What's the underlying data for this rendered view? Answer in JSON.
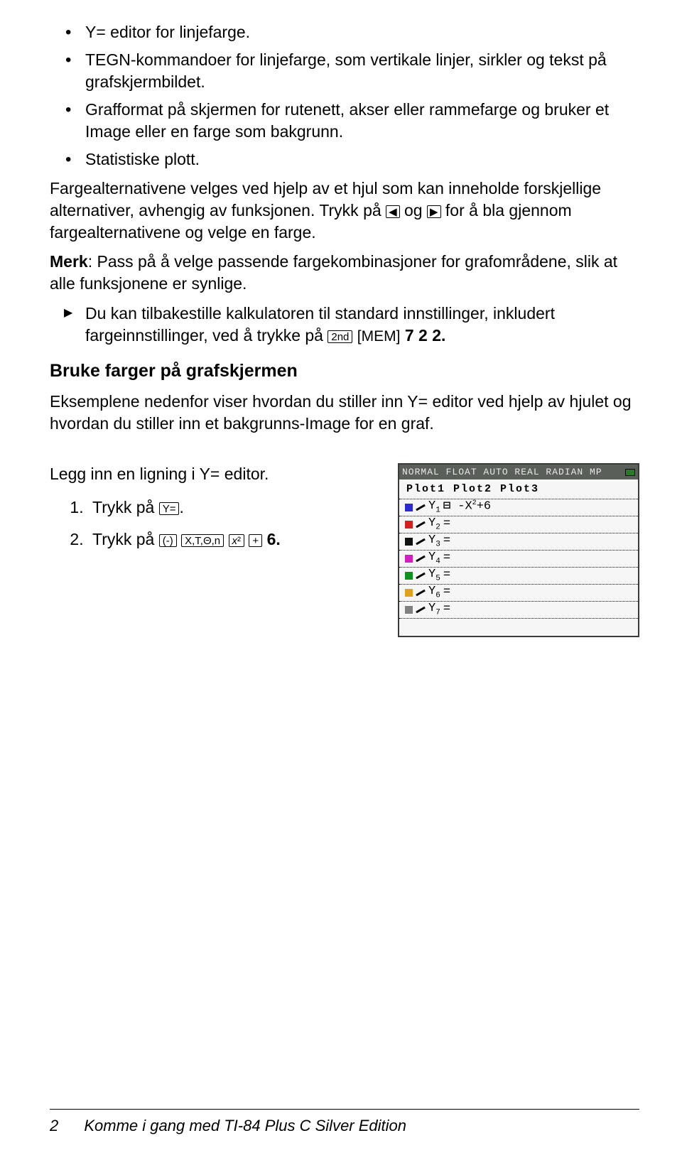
{
  "bullets": [
    "Y= editor for linjefarge.",
    "TEGN-kommandoer for linjefarge, som vertikale linjer, sirkler og tekst på grafskjermbildet.",
    "Grafformat på skjermen for rutenett, akser eller rammefarge og bruker et Image eller en farge som bakgrunn.",
    "Statistiske plott."
  ],
  "para1_a": "Fargealternativene velges ved hjelp av et hjul som kan inneholde forskjellige alternativer, avhengig av funksjonen. Trykk på ",
  "para1_b": " og ",
  "para1_c": " for å bla gjennom fargealternativene og velge en farge.",
  "merk_label": "Merk",
  "merk_text": ": Pass på å velge passende fargekombinasjoner for grafområdene, slik at alle funksjonene er synlige.",
  "tri_a": "Du kan tilbakestille kalkulatoren til standard innstillinger, inkludert fargeinnstillinger, ved å trykke på ",
  "key_2nd": "2nd",
  "key_mem": "[MEM]",
  "tri_b": " 7 2 2.",
  "section": "Bruke farger på grafskjermen",
  "section_body": "Eksemplene nedenfor viser hvordan du stiller inn Y= editor ved hjelp av hjulet og hvordan du stiller inn et bakgrunns-Image for en graf.",
  "legg": "Legg inn en ligning i Y= editor.",
  "step1_a": "Trykk på ",
  "key_yeq": "Y=",
  "step1_b": ".",
  "step2_a": "Trykk på ",
  "key_neg": "(-)",
  "key_xtn": "X,T,Θ,n",
  "key_x2": "x²",
  "key_plus": "+",
  "step2_b": " 6.",
  "calc_header": "NORMAL FLOAT AUTO REAL RADIAN MP",
  "plots": "Plot1  Plot2  Plot3",
  "rows": [
    {
      "c": "#2a2ad0",
      "t": "Y1",
      "eq": "= -X²+6",
      "bold": true
    },
    {
      "c": "#d02020",
      "t": "Y2",
      "eq": "="
    },
    {
      "c": "#101010",
      "t": "Y3",
      "eq": "="
    },
    {
      "c": "#d020c0",
      "t": "Y4",
      "eq": "="
    },
    {
      "c": "#109020",
      "t": "Y5",
      "eq": "="
    },
    {
      "c": "#e0a020",
      "t": "Y6",
      "eq": "="
    },
    {
      "c": "#808080",
      "t": "Y7",
      "eq": "="
    }
  ],
  "footer_page": "2",
  "footer_text": "Komme i gang med TI-84 Plus C Silver Edition"
}
